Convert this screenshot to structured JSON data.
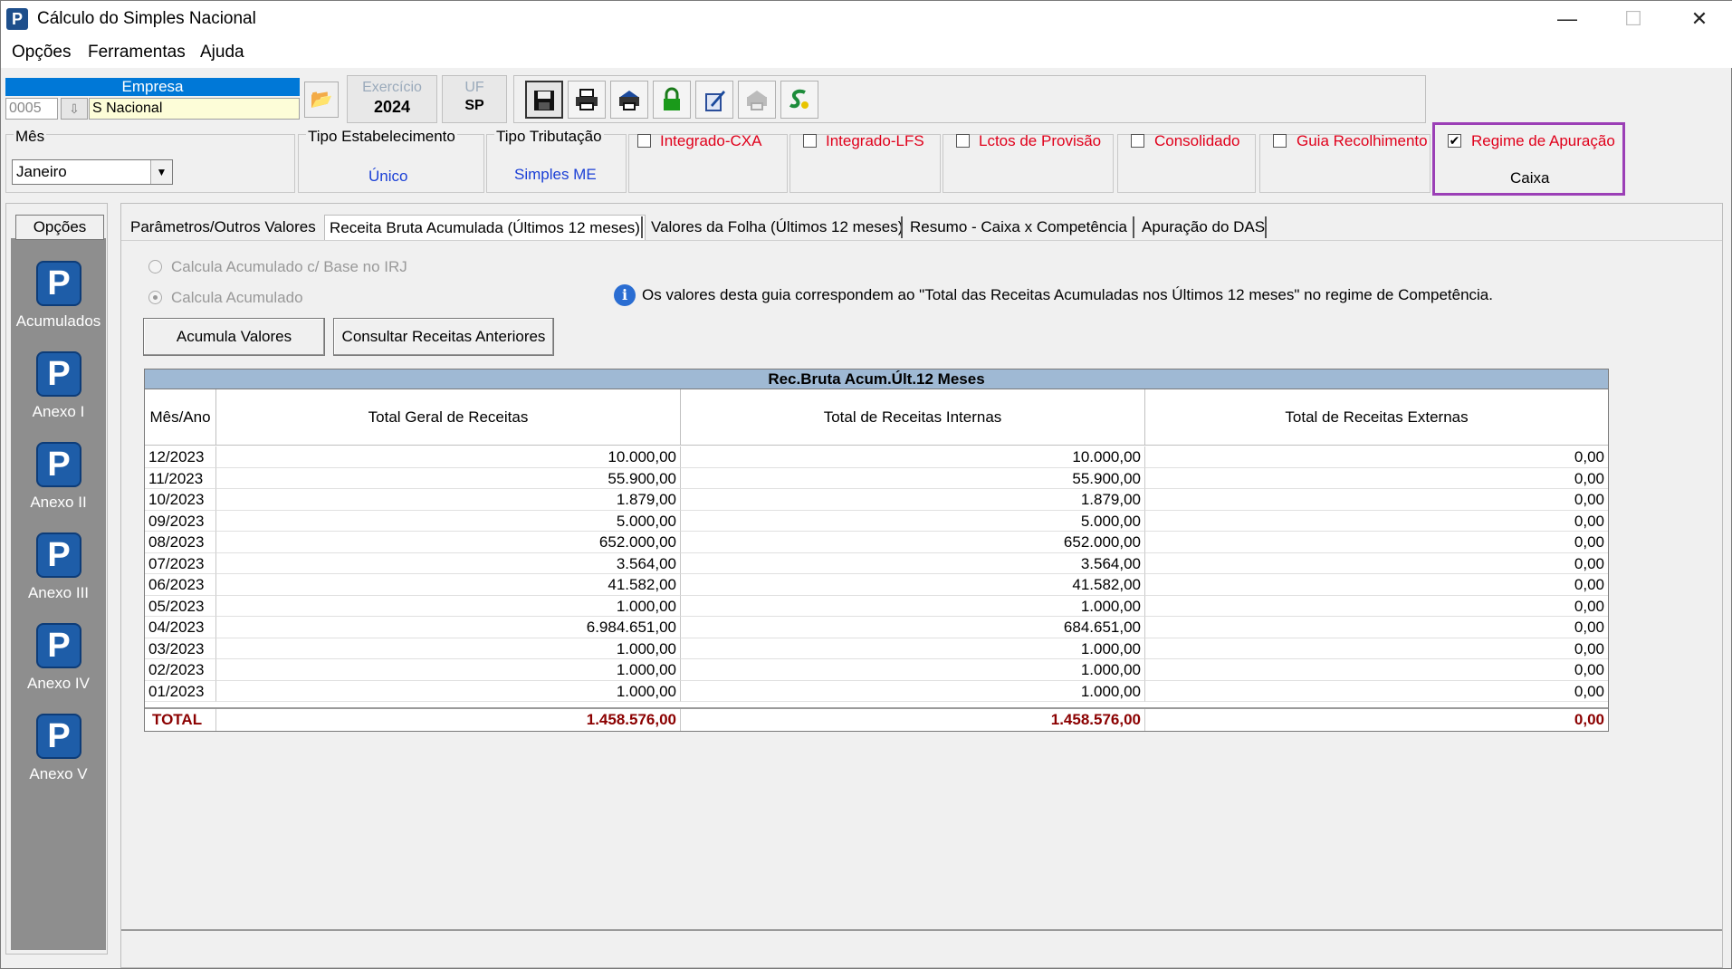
{
  "window": {
    "title": "Cálculo do Simples Nacional",
    "app_icon": "P",
    "controls": {
      "minimize": "—",
      "maximize": "☐",
      "close": "✕"
    }
  },
  "menu": [
    "Opções",
    "Ferramentas",
    "Ajuda"
  ],
  "empresa": {
    "label": "Empresa",
    "code": "0005",
    "name": "S Nacional"
  },
  "exercicio": {
    "label": "Exercício",
    "value": "2024"
  },
  "uf": {
    "label": "UF",
    "value": "SP"
  },
  "toolbar_icons": [
    "save-icon",
    "print-icon",
    "printer-setup-icon",
    "lock-icon",
    "edit-icon",
    "disabled-printer-icon",
    "simples-icon"
  ],
  "mes": {
    "label": "Mês",
    "value": "Janeiro"
  },
  "tipo_estabelecimento": {
    "label": "Tipo Estabelecimento",
    "value": "Único"
  },
  "tipo_tributacao": {
    "label": "Tipo Tributação",
    "value": "Simples ME"
  },
  "flags": [
    {
      "label": "Integrado-CXA",
      "checked": false
    },
    {
      "label": "Integrado-LFS",
      "checked": false
    },
    {
      "label": "Lctos de Provisão",
      "checked": false
    },
    {
      "label": "Consolidado",
      "checked": false
    },
    {
      "label": "Guia Recolhimento",
      "checked": false
    },
    {
      "label": "Regime de Apuração",
      "checked": true,
      "value": "Caixa"
    }
  ],
  "side": {
    "opcoes": "Opções",
    "items": [
      "Acumulados",
      "Anexo I",
      "Anexo II",
      "Anexo III",
      "Anexo IV",
      "Anexo V"
    ]
  },
  "tabs": [
    {
      "label": "Parâmetros/Outros Valores",
      "active": false
    },
    {
      "label": "Receita Bruta Acumulada (Últimos 12 meses)",
      "active": true
    },
    {
      "label": "Valores da Folha (Últimos 12 meses)",
      "active": false
    },
    {
      "label": "Resumo - Caixa x Competência",
      "active": false
    },
    {
      "label": "Apuração do DAS",
      "active": false
    }
  ],
  "radios": [
    {
      "label": "Calcula Acumulado c/ Base no IRJ",
      "selected": false
    },
    {
      "label": "Calcula Acumulado",
      "selected": true
    }
  ],
  "info": "Os valores desta guia correspondem ao \"Total das Receitas Acumuladas nos Últimos 12 meses\" no regime de Competência.",
  "buttons": {
    "acumula": "Acumula Valores",
    "consultar": "Consultar Receitas Anteriores"
  },
  "grid": {
    "title": "Rec.Bruta Acum.Últ.12 Meses",
    "headers": [
      "Mês/Ano",
      "Total Geral de Receitas",
      "Total de Receitas Internas",
      "Total de Receitas Externas"
    ],
    "rows": [
      [
        "12/2023",
        "10.000,00",
        "10.000,00",
        "0,00"
      ],
      [
        "11/2023",
        "55.900,00",
        "55.900,00",
        "0,00"
      ],
      [
        "10/2023",
        "1.879,00",
        "1.879,00",
        "0,00"
      ],
      [
        "09/2023",
        "5.000,00",
        "5.000,00",
        "0,00"
      ],
      [
        "08/2023",
        "652.000,00",
        "652.000,00",
        "0,00"
      ],
      [
        "07/2023",
        "3.564,00",
        "3.564,00",
        "0,00"
      ],
      [
        "06/2023",
        "41.582,00",
        "41.582,00",
        "0,00"
      ],
      [
        "05/2023",
        "1.000,00",
        "1.000,00",
        "0,00"
      ],
      [
        "04/2023",
        "6.984.651,00",
        "684.651,00",
        "0,00"
      ],
      [
        "03/2023",
        "1.000,00",
        "1.000,00",
        "0,00"
      ],
      [
        "02/2023",
        "1.000,00",
        "1.000,00",
        "0,00"
      ],
      [
        "01/2023",
        "1.000,00",
        "1.000,00",
        "0,00"
      ]
    ],
    "total": [
      "TOTAL",
      "1.458.576,00",
      "1.458.576,00",
      "0,00"
    ]
  },
  "colors": {
    "accent": "#0078d7",
    "flag_red": "#e0001b",
    "value_blue": "#1a3fd6",
    "total_red": "#8b0000",
    "highlight": "#9b3fb6",
    "grid_header": "#9fb9d4"
  }
}
